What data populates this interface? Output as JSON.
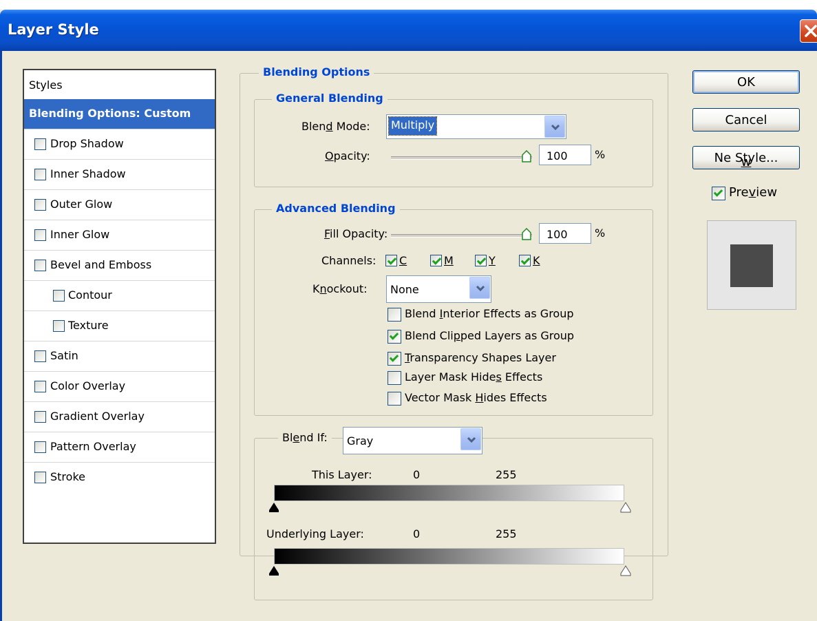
{
  "window": {
    "title": "Layer Style"
  },
  "styles_list": {
    "header": "Styles",
    "selected": "Blending Options: Custom",
    "items": [
      {
        "label": "Drop Shadow",
        "checked": false
      },
      {
        "label": "Inner Shadow",
        "checked": false
      },
      {
        "label": "Outer Glow",
        "checked": false
      },
      {
        "label": "Inner Glow",
        "checked": false
      },
      {
        "label": "Bevel and Emboss",
        "checked": false
      },
      {
        "label": "Contour",
        "checked": false
      },
      {
        "label": "Texture",
        "checked": false
      },
      {
        "label": "Satin",
        "checked": false
      },
      {
        "label": "Color Overlay",
        "checked": false
      },
      {
        "label": "Gradient Overlay",
        "checked": false
      },
      {
        "label": "Pattern Overlay",
        "checked": false
      },
      {
        "label": "Stroke",
        "checked": false
      }
    ]
  },
  "blending_options": {
    "title": "Blending Options",
    "general": {
      "title": "General Blending",
      "blend_mode_label": "Blend Mode:",
      "blend_mode_value": "Multiply",
      "opacity_label": "Opacity:",
      "opacity_value": "100",
      "opacity_level": 1.0,
      "percent": "%"
    },
    "advanced": {
      "title": "Advanced Blending",
      "fill_opacity_label": "Fill Opacity:",
      "fill_opacity_value": "100",
      "fill_opacity_level": 1.0,
      "percent": "%",
      "channels_label": "Channels:",
      "channels": [
        {
          "label": "C",
          "checked": true
        },
        {
          "label": "M",
          "checked": true
        },
        {
          "label": "Y",
          "checked": true
        },
        {
          "label": "K",
          "checked": true
        }
      ],
      "knockout_label": "Knockout:",
      "knockout_value": "None",
      "options": [
        {
          "label": "Blend Interior Effects as Group",
          "checked": false
        },
        {
          "label": "Blend Clipped Layers as Group",
          "checked": true
        },
        {
          "label": "Transparency Shapes Layer",
          "checked": true
        },
        {
          "label": "Layer Mask Hides Effects",
          "checked": false
        },
        {
          "label": "Vector Mask Hides Effects",
          "checked": false
        }
      ]
    },
    "blend_if": {
      "label": "Blend If:",
      "value": "Gray",
      "this_layer_label": "This Layer:",
      "this_layer_min": "0",
      "this_layer_max": "255",
      "underlying_label": "Underlying Layer:",
      "underlying_min": "0",
      "underlying_max": "255"
    }
  },
  "buttons": {
    "ok": "OK",
    "cancel": "Cancel",
    "new_style": "New Style..."
  },
  "preview": {
    "label": "Preview",
    "checked": true
  },
  "colors": {
    "title_bar": "#0553d6",
    "selection": "#316ac5",
    "group_title": "#0046d5",
    "check": "#21a121"
  }
}
